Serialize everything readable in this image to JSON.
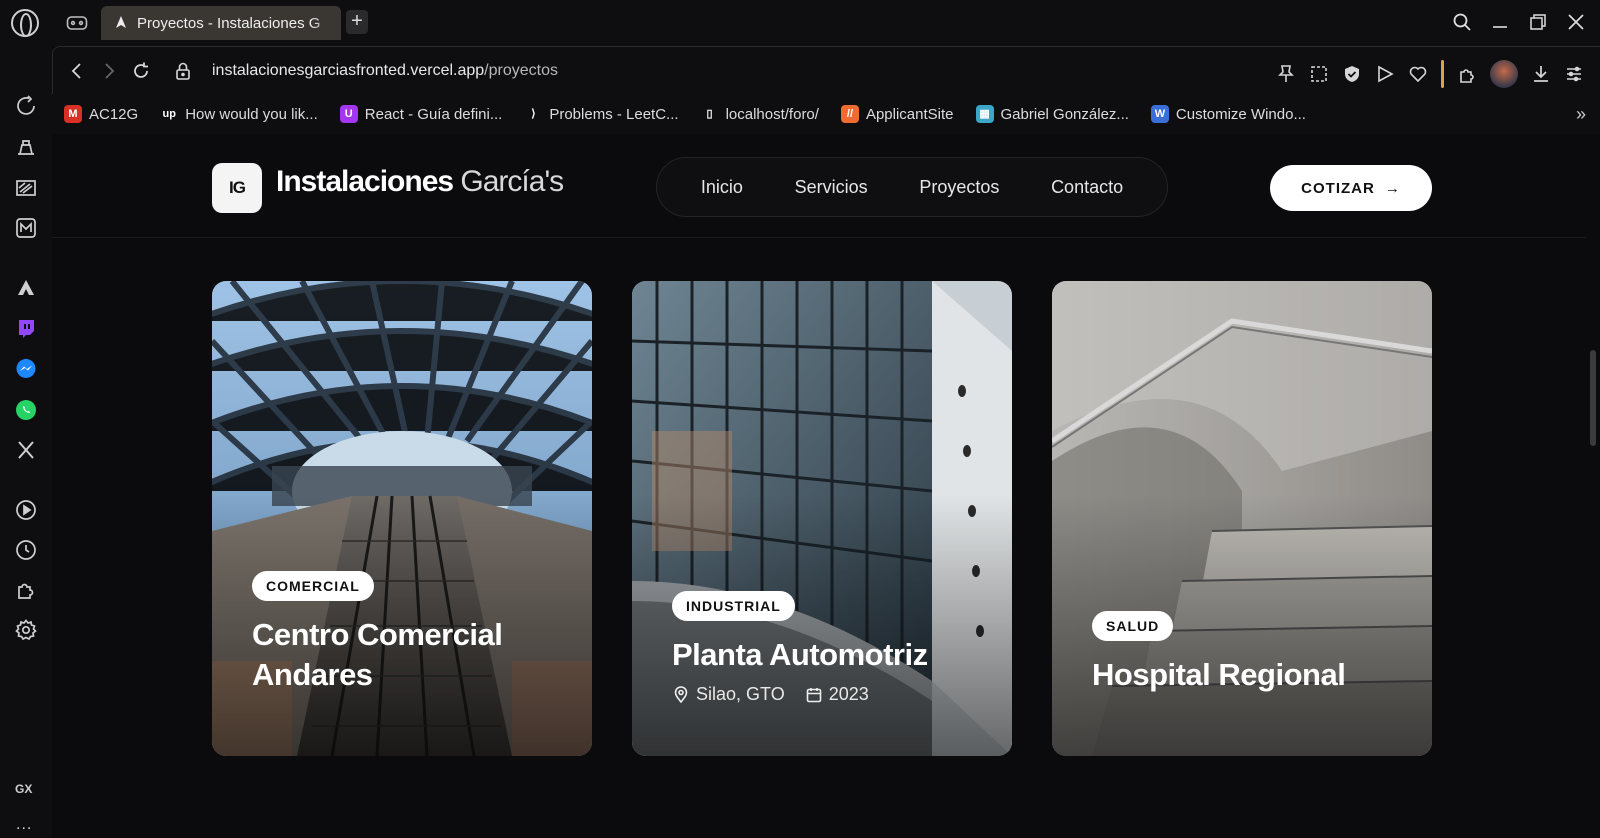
{
  "browser": {
    "tab_title": "Proyectos - Instalaciones G",
    "url_host": "instalacionesgarciasfronted.vercel.app",
    "url_path": "/proyectos",
    "new_tab_label": "+",
    "sidebar_gx_label": "GX",
    "sidebar_more_label": "...",
    "bookmarks": [
      {
        "label": "AC12G",
        "icon": "gmail-icon",
        "color": "#d93025",
        "glyph": "M"
      },
      {
        "label": "How would you lik...",
        "icon": "upwork-icon",
        "color": "#0e0e10",
        "glyph": "up"
      },
      {
        "label": "React - Guía defini...",
        "icon": "udemy-icon",
        "color": "#a435f0",
        "glyph": "U"
      },
      {
        "label": "Problems - LeetC...",
        "icon": "leetcode-icon",
        "color": "#0e0e10",
        "glyph": "⟩"
      },
      {
        "label": "localhost/foro/",
        "icon": "page-icon",
        "color": "#0e0e10",
        "glyph": "▯"
      },
      {
        "label": "ApplicantSite",
        "icon": "applicantsite-icon",
        "color": "#f06b2f",
        "glyph": "//"
      },
      {
        "label": "Gabriel González...",
        "icon": "profile-icon",
        "color": "#3aa7c9",
        "glyph": "▦"
      },
      {
        "label": "Customize Windo...",
        "icon": "windows-icon",
        "color": "#3a6fd8",
        "glyph": "W"
      }
    ]
  },
  "site": {
    "logo_initials": "IG",
    "brand_bold": "Instalaciones",
    "brand_light": " García's",
    "nav": [
      "Inicio",
      "Servicios",
      "Proyectos",
      "Contacto"
    ],
    "cta_label": "COTIZAR",
    "cta_arrow": "→"
  },
  "projects": [
    {
      "badge": "COMERCIAL",
      "title_line1": "Centro Comercial",
      "title_line2": "Andares"
    },
    {
      "badge": "INDUSTRIAL",
      "title_line1": "Planta Automotriz",
      "location": "Silao, GTO",
      "year": "2023"
    },
    {
      "badge": "SALUD",
      "title_line1": "Hospital Regional"
    }
  ],
  "colors": {
    "page_bg": "#0b0b0d",
    "accent": "#ffffff",
    "tab_bg": "#3a3733"
  }
}
